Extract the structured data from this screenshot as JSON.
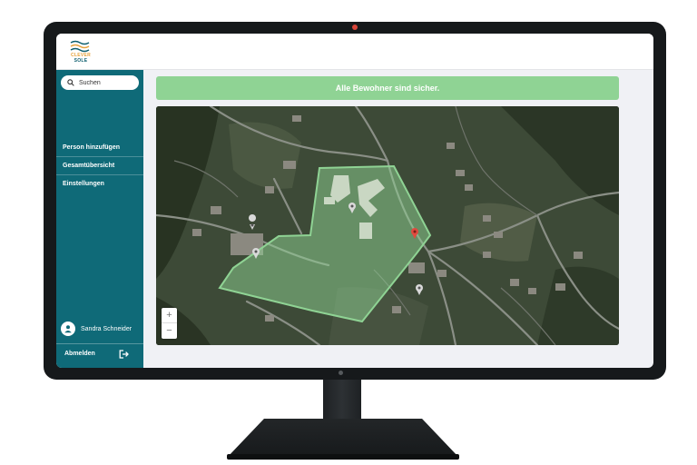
{
  "app": {
    "logo_top": "CLEVER",
    "logo_bottom": "SOLE"
  },
  "sidebar": {
    "search_placeholder": "Suchen",
    "items": [
      {
        "label": "Person hinzufügen"
      },
      {
        "label": "Gesamtübersicht"
      },
      {
        "label": "Einstellungen"
      }
    ],
    "user_name": "Sandra Schneider",
    "logout_label": "Abmelden"
  },
  "status": {
    "message": "Alle Bewohner sind sicher.",
    "color": "#8fd394"
  },
  "map": {
    "type": "satellite",
    "geofence_color": "#8fd394",
    "pins": [
      {
        "icon": "location-pin-icon"
      },
      {
        "icon": "location-pin-icon"
      },
      {
        "icon": "location-pin-icon"
      },
      {
        "icon": "location-pin-icon"
      },
      {
        "icon": "red-location-pin-icon"
      }
    ],
    "zoom_in_label": "+",
    "zoom_out_label": "−"
  },
  "colors": {
    "sidebar": "#0f6a78",
    "accent": "#e6a23c"
  }
}
